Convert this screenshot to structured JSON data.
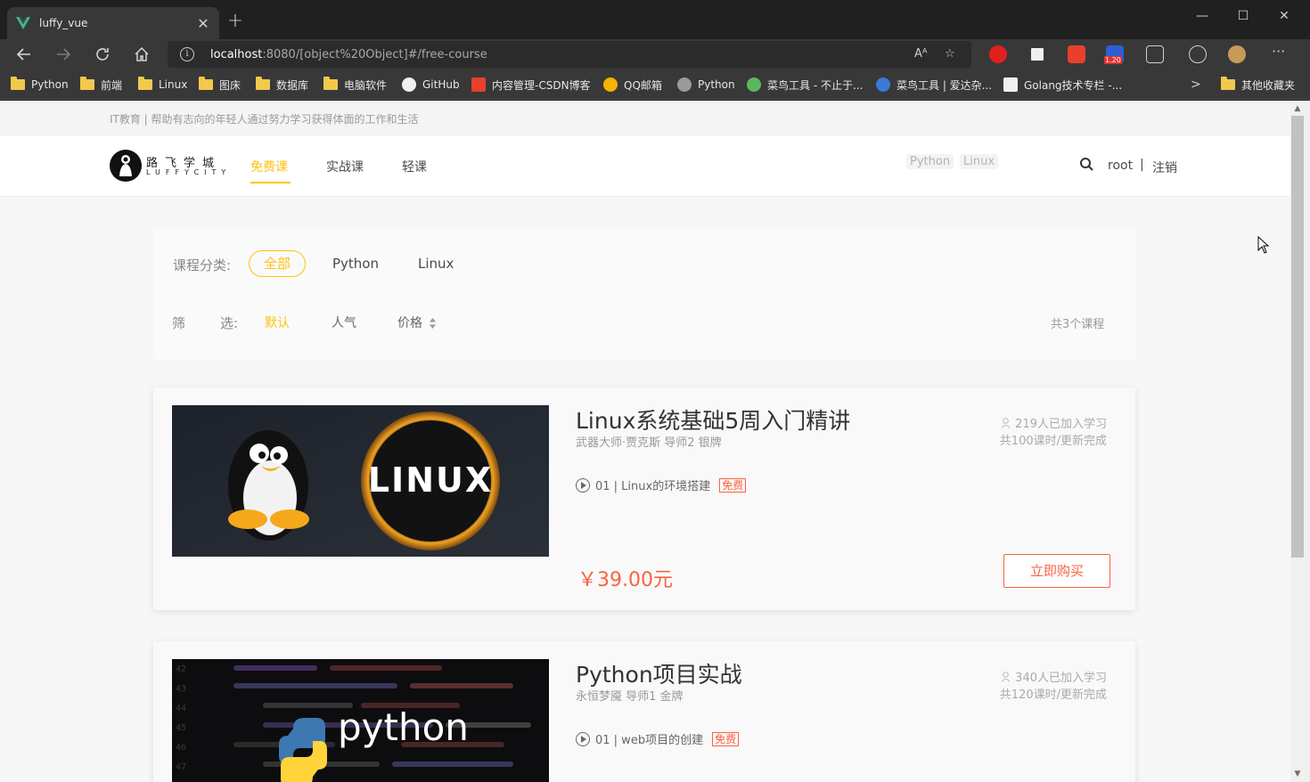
{
  "browser": {
    "tab_title": "luffy_vue",
    "address_host": "localhost",
    "address_path": ":8080/[object%20Object]#/free-course",
    "ext_badge": "1.20",
    "bookmarks": [
      "Python",
      "前端",
      "Linux",
      "图床",
      "数据库",
      "电脑软件",
      "GitHub",
      "内容管理-CSDN博客",
      "QQ邮箱",
      "Python",
      "菜鸟工具 - 不止于...",
      "菜鸟工具 | 爱达杂...",
      "Golang技术专栏 -...",
      "其他收藏夹"
    ]
  },
  "site": {
    "slogan": "IT教育 | 帮助有志向的年轻人通过努力学习获得体面的工作和生活",
    "logo_title": "路飞学城",
    "logo_sub": "LUFFYCITY",
    "nav": [
      "免费课",
      "实战课",
      "轻课"
    ],
    "search_tags": [
      "Python",
      "Linux"
    ],
    "user": "root",
    "user_sep": "|",
    "logout": "注销"
  },
  "filters": {
    "category_label": "课程分类:",
    "categories": [
      "全部",
      "Python",
      "Linux"
    ],
    "sort_label_1": "筛",
    "sort_label_2": "选:",
    "sorts": [
      "默认",
      "人气",
      "价格"
    ],
    "total": "共3个课程"
  },
  "courses": [
    {
      "title": "Linux系统基础5周入门精讲",
      "teacher": "武器大师·贾克斯 导师2 银牌",
      "students": "219人已加入学习",
      "lessons": "共100课时/更新完成",
      "lesson": "01 | Linux的环境搭建",
      "badge": "免费",
      "price": "￥39.00元",
      "buy": "立即购买",
      "image_text": "LINUX"
    },
    {
      "title": "Python项目实战",
      "teacher": "永恒梦魇 导师1 金牌",
      "students": "340人已加入学习",
      "lessons": "共120课时/更新完成",
      "lesson": "01 | web项目的创建",
      "badge": "免费",
      "image_text": "python"
    }
  ],
  "colors": {
    "accent": "#ffc210",
    "price": "#fa6240"
  }
}
